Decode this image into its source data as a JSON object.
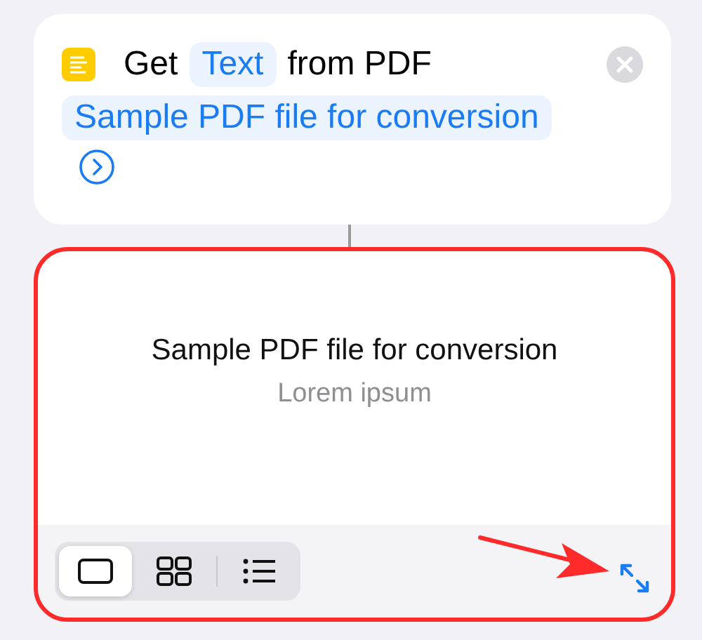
{
  "action": {
    "verb": "Get",
    "parameter": "Text",
    "connector": "from PDF",
    "input": "Sample PDF file for conversion"
  },
  "result": {
    "highlighted": true,
    "title": "Sample PDF file for conversion",
    "subtitle": "Lorem ipsum"
  },
  "view_modes": [
    {
      "kind": "single",
      "selected": true
    },
    {
      "kind": "grid",
      "selected": false
    },
    {
      "kind": "list",
      "selected": false
    }
  ]
}
